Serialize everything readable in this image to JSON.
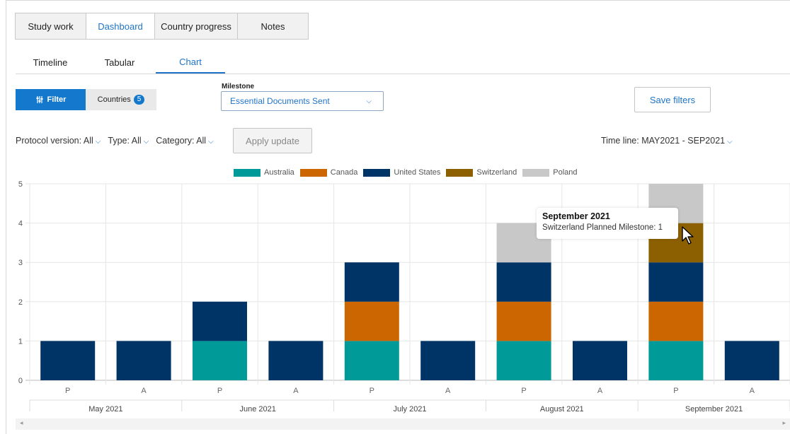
{
  "top_tabs": [
    "Study work",
    "Dashboard",
    "Country progress",
    "Notes"
  ],
  "active_top_tab": "Dashboard",
  "sub_tabs": [
    "Timeline",
    "Tabular",
    "Chart"
  ],
  "active_sub_tab": "Chart",
  "filter": {
    "filter_label": "Filter",
    "countries_label": "Countries",
    "countries_count": "5",
    "milestone_label": "Milestone",
    "milestone_value": "Essential Documents Sent",
    "save_label": "Save filters",
    "protocol_label": "Protocol version: All",
    "type_label": "Type: All",
    "category_label": "Category: All",
    "apply_label": "Apply update",
    "timeline_label": "Time line:",
    "timeline_value": "MAY2021 - SEP2021"
  },
  "colors": {
    "accent": "#1479cc",
    "Australia": "#009a98",
    "Canada": "#cc6600",
    "United States": "#003366",
    "Switzerland": "#8c6000",
    "Poland": "#c8c8c8"
  },
  "chart_data": {
    "type": "bar",
    "stacked": true,
    "legend_position": "top-center",
    "grid": true,
    "ylim": [
      0,
      5
    ],
    "yticks": [
      "0",
      "1",
      "2",
      "3",
      "4",
      "5"
    ],
    "groups": [
      "May 2021",
      "June 2021",
      "July 2021",
      "August 2021",
      "September 2021"
    ],
    "subcategories": [
      "P",
      "A"
    ],
    "series": [
      {
        "name": "Australia",
        "values": [
          [
            0,
            0
          ],
          [
            1,
            0
          ],
          [
            1,
            0
          ],
          [
            1,
            0
          ],
          [
            1,
            0
          ]
        ]
      },
      {
        "name": "Canada",
        "values": [
          [
            0,
            0
          ],
          [
            0,
            0
          ],
          [
            1,
            0
          ],
          [
            1,
            0
          ],
          [
            1,
            0
          ]
        ]
      },
      {
        "name": "United States",
        "values": [
          [
            1,
            1
          ],
          [
            1,
            1
          ],
          [
            1,
            1
          ],
          [
            1,
            1
          ],
          [
            1,
            1
          ]
        ]
      },
      {
        "name": "Switzerland",
        "values": [
          [
            0,
            0
          ],
          [
            0,
            0
          ],
          [
            0,
            0
          ],
          [
            0,
            0
          ],
          [
            1,
            0
          ]
        ]
      },
      {
        "name": "Poland",
        "values": [
          [
            0,
            0
          ],
          [
            0,
            0
          ],
          [
            0,
            0
          ],
          [
            1,
            0
          ],
          [
            1,
            0
          ]
        ]
      }
    ]
  },
  "tooltip": {
    "title": "September 2021",
    "body": "Switzerland Planned Milestone: 1"
  },
  "scroll": {
    "left_arrow": "◂",
    "right_arrow": "▸"
  }
}
